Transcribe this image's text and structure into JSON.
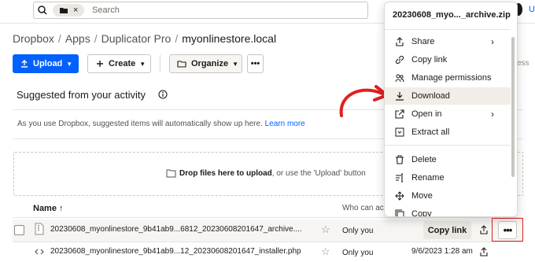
{
  "search": {
    "placeholder": "Search",
    "chip_close": "×"
  },
  "user": {
    "initial": "U"
  },
  "breadcrumb": {
    "items": [
      "Dropbox",
      "Apps",
      "Duplicator Pro"
    ],
    "current": "myonlinestore.local",
    "separator": "/"
  },
  "toolbar": {
    "upload_label": "Upload",
    "create_label": "Create",
    "organize_label": "Organize",
    "more_label": "•••",
    "access_fragment": "cess"
  },
  "suggested": {
    "title": "Suggested from your activity",
    "hide_fragment": "e",
    "message": "As you use Dropbox, suggested items will automatically show up here.",
    "learn_more": "Learn more"
  },
  "dropzone": {
    "bold": "Drop files here to upload",
    "rest": ", or use the 'Upload' button"
  },
  "table": {
    "headers": {
      "name": "Name ↑",
      "who": "Who can ac"
    },
    "rows": [
      {
        "name": "20230608_myonlinestore_9b41ab9...6812_20230608201647_archive....",
        "who": "Only you",
        "copy_link": "Copy link",
        "more": "•••"
      },
      {
        "name": "20230608_myonlinestore_9b41ab9...12_20230608201647_installer.php",
        "who": "Only you",
        "modified": "9/6/2023 1:28 am"
      }
    ]
  },
  "menu": {
    "title": "20230608_myo..._archive.zip",
    "items": [
      {
        "label": "Share",
        "icon": "share-icon",
        "submenu": true
      },
      {
        "label": "Copy link",
        "icon": "link-icon"
      },
      {
        "label": "Manage permissions",
        "icon": "people-icon"
      },
      {
        "label": "Download",
        "icon": "download-icon",
        "highlighted": true
      },
      {
        "label": "Open in",
        "icon": "open-in-icon",
        "submenu": true
      },
      {
        "label": "Extract all",
        "icon": "extract-icon"
      },
      {
        "label": "Delete",
        "icon": "trash-icon"
      },
      {
        "label": "Rename",
        "icon": "rename-icon"
      },
      {
        "label": "Move",
        "icon": "move-icon"
      },
      {
        "label": "Copy",
        "icon": "copy-icon"
      }
    ],
    "submenu_arrow": "›"
  },
  "colors": {
    "accent": "#0061fe",
    "annotation": "#e02020",
    "highlight": "#f2ede7"
  }
}
